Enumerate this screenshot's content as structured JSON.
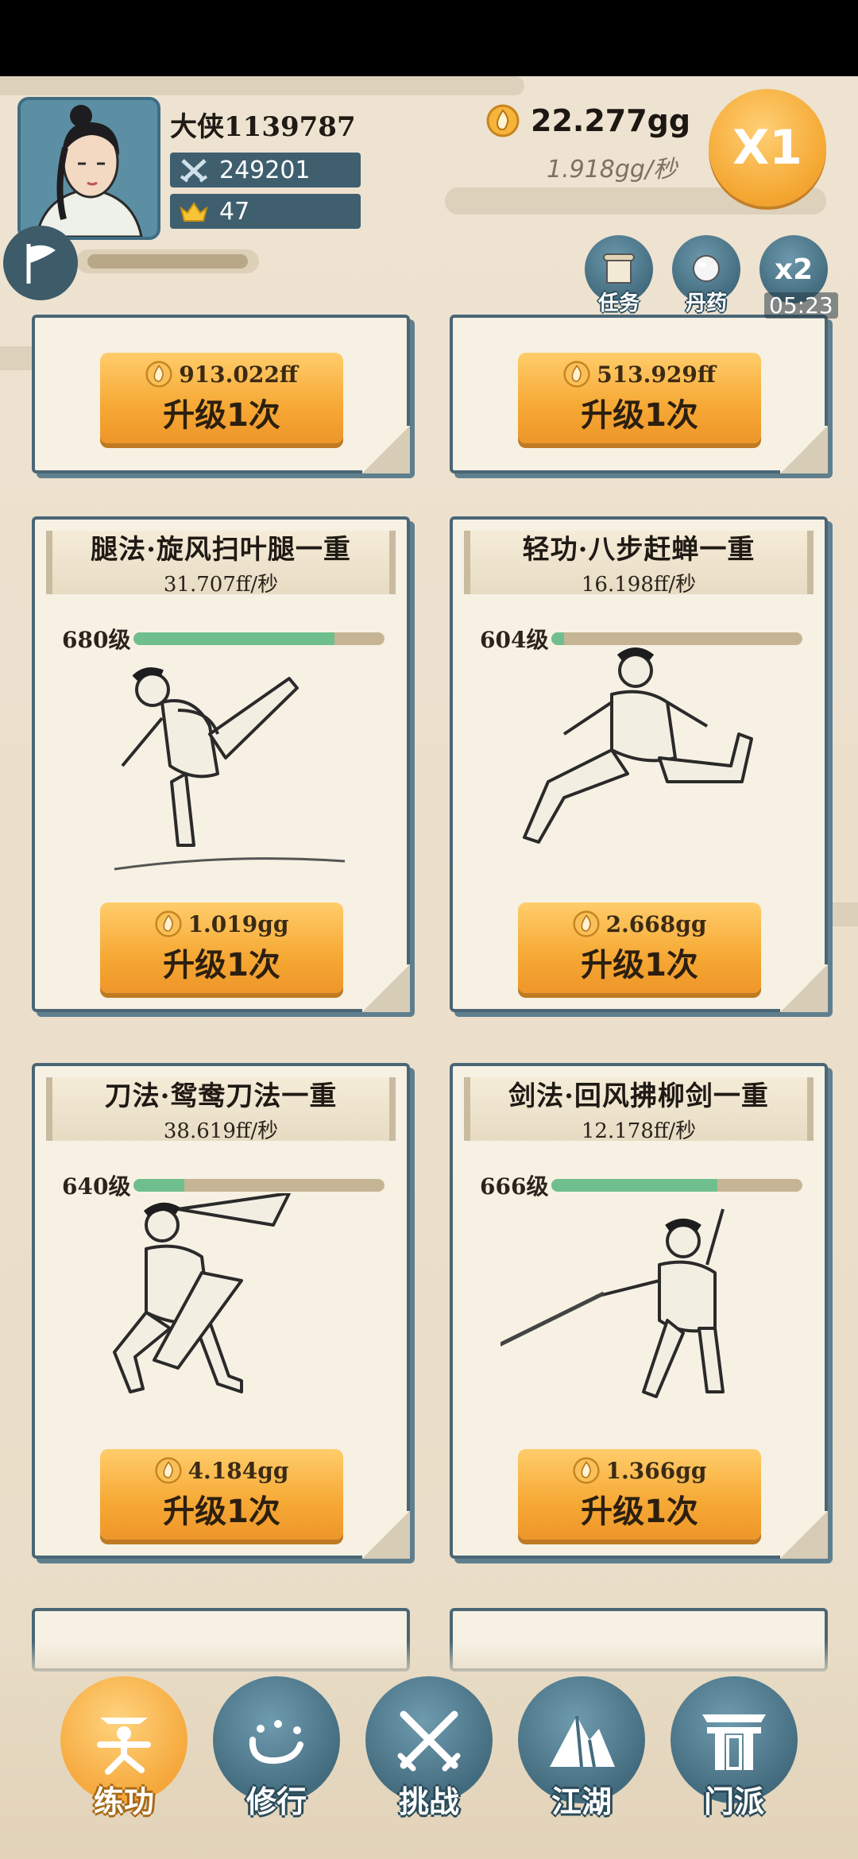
{
  "player": {
    "name": "大侠1139787",
    "combat_power": "249201",
    "gold_ingots": "47",
    "avatar_icon": "hero-portrait",
    "flag_icon": "flag-icon"
  },
  "currency": {
    "amount": "22.277gg",
    "rate": "1.918gg/秒",
    "icon": "flame-coin-icon"
  },
  "speed_button": {
    "label": "X1"
  },
  "quick_buttons": [
    {
      "label": "任务",
      "icon": "scroll-icon"
    },
    {
      "label": "丹药",
      "icon": "pill-icon"
    },
    {
      "label": "x2",
      "timer": "05:23"
    }
  ],
  "partial_cards": [
    {
      "cost": "913.022ff",
      "action": "升级1次"
    },
    {
      "cost": "513.929ff",
      "action": "升级1次"
    }
  ],
  "cards": [
    {
      "name": "腿法·旋风扫叶腿一重",
      "rate": "31.707ff/秒",
      "level": "680级",
      "progress": 0.8,
      "cost": "1.019gg",
      "action": "升级1次",
      "figure": "kick-figure"
    },
    {
      "name": "轻功·八步赶蝉一重",
      "rate": "16.198ff/秒",
      "level": "604级",
      "progress": 0.05,
      "cost": "2.668gg",
      "action": "升级1次",
      "figure": "leap-figure"
    },
    {
      "name": "刀法·鸳鸯刀法一重",
      "rate": "38.619ff/秒",
      "level": "640级",
      "progress": 0.2,
      "cost": "4.184gg",
      "action": "升级1次",
      "figure": "sword-figure"
    },
    {
      "name": "剑法·回风拂柳剑一重",
      "rate": "12.178ff/秒",
      "level": "666级",
      "progress": 0.66,
      "cost": "1.366gg",
      "action": "升级1次",
      "figure": "fencing-figure"
    }
  ],
  "bottom_nav": [
    {
      "label": "练功",
      "icon": "practice-icon",
      "active": true
    },
    {
      "label": "修行",
      "icon": "heart-icon",
      "active": false
    },
    {
      "label": "挑战",
      "icon": "crossed-swords-icon",
      "active": false
    },
    {
      "label": "江湖",
      "icon": "mountain-icon",
      "active": false
    },
    {
      "label": "门派",
      "icon": "gate-icon",
      "active": false
    }
  ],
  "colors": {
    "accent_orange": "#f6a834",
    "teal": "#436b7e",
    "paper": "#f7f1e4",
    "progress_green": "#6fbf8e"
  }
}
